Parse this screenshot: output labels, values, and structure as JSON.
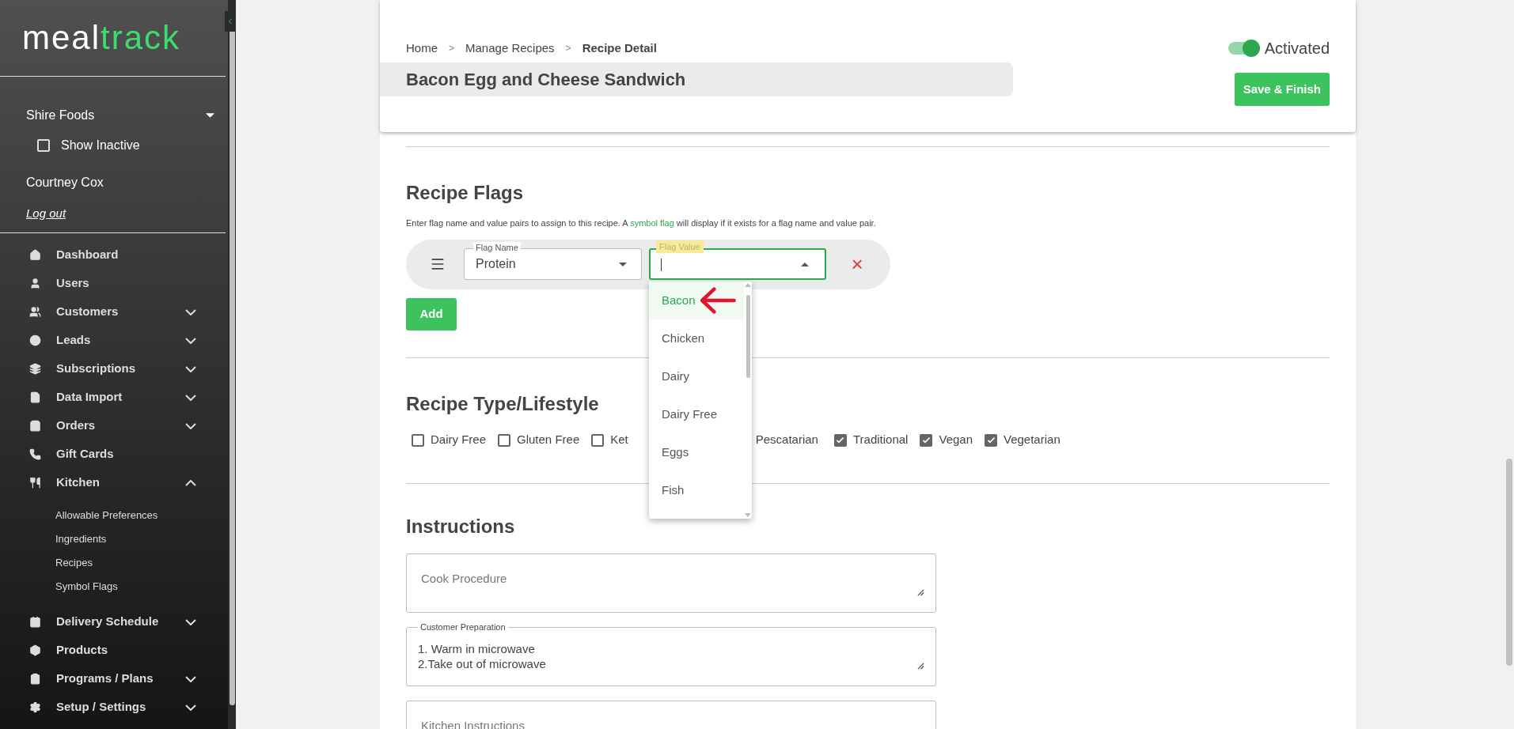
{
  "sidebar": {
    "logo": [
      {
        "text": "meal",
        "color": "#ffffff"
      },
      {
        "text": "track",
        "color": "#3ddc6e"
      }
    ],
    "company": "Shire Foods",
    "show_inactive": {
      "label": "Show Inactive",
      "checked": false
    },
    "user": "Courtney Cox",
    "logout": "Log out",
    "nav": [
      {
        "label": "Dashboard",
        "kind": "link"
      },
      {
        "label": "Users",
        "kind": "link"
      },
      {
        "label": "Customers",
        "kind": "group",
        "expanded": false
      },
      {
        "label": "Leads",
        "kind": "group",
        "expanded": false
      },
      {
        "label": "Subscriptions",
        "kind": "group",
        "expanded": false
      },
      {
        "label": "Data Import",
        "kind": "group",
        "expanded": false
      },
      {
        "label": "Orders",
        "kind": "group",
        "expanded": false
      },
      {
        "label": "Gift Cards",
        "kind": "link"
      },
      {
        "label": "Kitchen",
        "kind": "group",
        "expanded": true,
        "children": [
          "Allowable Preferences",
          "Ingredients",
          "Recipes",
          "Symbol Flags"
        ]
      },
      {
        "label": "Delivery Schedule",
        "kind": "group",
        "expanded": false
      },
      {
        "label": "Products",
        "kind": "link"
      },
      {
        "label": "Programs / Plans",
        "kind": "group",
        "expanded": false
      },
      {
        "label": "Setup / Settings",
        "kind": "group",
        "expanded": false
      }
    ]
  },
  "header": {
    "breadcrumbs": [
      {
        "label": "Home",
        "selected": false
      },
      {
        "label": "Manage Recipes",
        "selected": false
      },
      {
        "label": "Recipe Detail",
        "selected": true
      }
    ],
    "breadcrumb_separator": ">",
    "title": "Bacon Egg and Cheese Sandwich",
    "activated": {
      "label": "Activated",
      "on": true
    },
    "save_button": "Save & Finish"
  },
  "recipe_flags": {
    "heading": "Recipe Flags",
    "description": {
      "before": "Enter flag name and value pairs to assign to this recipe. A ",
      "link": "symbol flag",
      "after": " will display if it exists for a flag name and value pair."
    },
    "flag_name": {
      "label": "Flag Name",
      "value": "Protein"
    },
    "flag_value": {
      "label": "Flag Value",
      "expanded": true,
      "options": [
        {
          "label": "Bacon",
          "selected": true
        },
        {
          "label": "Chicken",
          "selected": false
        },
        {
          "label": "Dairy",
          "selected": false
        },
        {
          "label": "Dairy Free",
          "selected": false
        },
        {
          "label": "Eggs",
          "selected": false
        },
        {
          "label": "Fish",
          "selected": false
        }
      ]
    },
    "remove_icon": "×",
    "add_button": "Add"
  },
  "lifestyle": {
    "heading": "Recipe Type/Lifestyle",
    "options": [
      {
        "label": "Dairy Free",
        "checked": false
      },
      {
        "label": "Gluten Free",
        "checked": false
      },
      {
        "label": "Ket",
        "checked": false
      },
      {
        "label": "Pescatarian",
        "kind": "covered"
      },
      {
        "label": "Traditional",
        "checked": true
      },
      {
        "label": "Vegan",
        "checked": true
      },
      {
        "label": "Vegetarian",
        "checked": true
      }
    ]
  },
  "instructions": {
    "heading": "Instructions",
    "fields": [
      {
        "label": "Cook Procedure"
      },
      {
        "label": "Customer Preparation",
        "value": "1. Warm in microwave\n2.Take out of microwave"
      },
      {
        "label": "Kitchen Instructions"
      }
    ]
  }
}
